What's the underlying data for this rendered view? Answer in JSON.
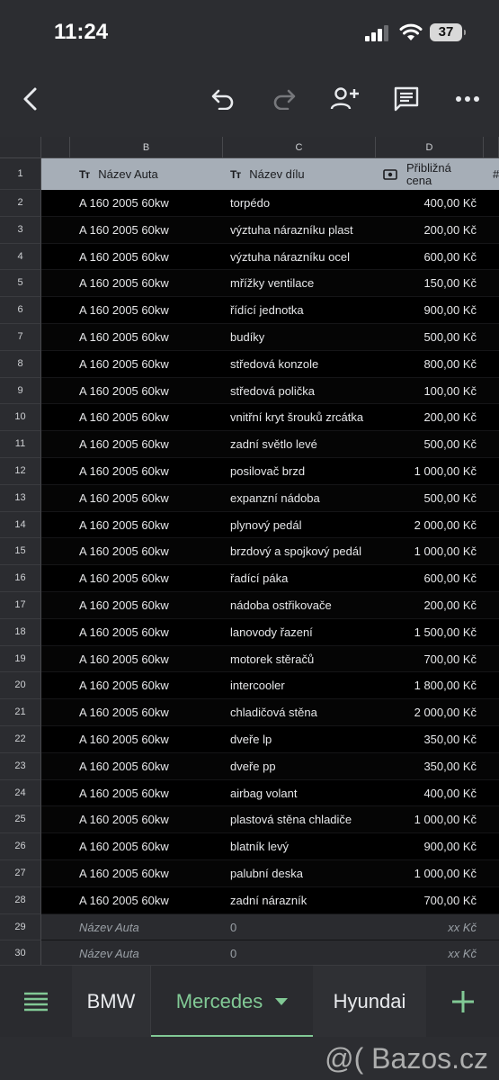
{
  "status_bar": {
    "time": "11:24",
    "battery": "37"
  },
  "toolbar": {
    "back": "back-icon",
    "undo": "undo-icon",
    "redo": "redo-icon",
    "share": "add-person-icon",
    "comments": "comment-icon",
    "more": "more-icon"
  },
  "columns": [
    "B",
    "C",
    "D"
  ],
  "header": {
    "row_number": "1",
    "col_b": "Název Auta",
    "col_c": "Název dílu",
    "col_d": "Přibližná cena",
    "col_d_line1": "Přibližná",
    "col_d_line2": "cena",
    "col_e": "#",
    "type_icon": "Tт"
  },
  "rows": [
    {
      "n": "2",
      "b": "A 160 2005 60kw",
      "c": "torpédo",
      "d": "400,00 Kč"
    },
    {
      "n": "3",
      "b": "A 160 2005 60kw",
      "c": "výztuha nárazníku plast",
      "d": "200,00 Kč"
    },
    {
      "n": "4",
      "b": "A 160 2005 60kw",
      "c": "výztuha nárazníku ocel",
      "d": "600,00 Kč"
    },
    {
      "n": "5",
      "b": "A 160 2005 60kw",
      "c": "mřížky ventilace",
      "d": "150,00 Kč"
    },
    {
      "n": "6",
      "b": "A 160 2005 60kw",
      "c": "řídící jednotka",
      "d": "900,00 Kč"
    },
    {
      "n": "7",
      "b": "A 160 2005 60kw",
      "c": "budíky",
      "d": "500,00 Kč"
    },
    {
      "n": "8",
      "b": "A 160 2005 60kw",
      "c": "středová konzole",
      "d": "800,00 Kč"
    },
    {
      "n": "9",
      "b": "A 160 2005 60kw",
      "c": "středová polička",
      "d": "100,00 Kč"
    },
    {
      "n": "10",
      "b": "A 160 2005 60kw",
      "c": "vnitřní kryt šrouků zrcátka",
      "d": "200,00 Kč"
    },
    {
      "n": "11",
      "b": "A 160 2005 60kw",
      "c": "zadní světlo levé",
      "d": "500,00 Kč"
    },
    {
      "n": "12",
      "b": "A 160 2005 60kw",
      "c": "posilovač brzd",
      "d": "1 000,00 Kč"
    },
    {
      "n": "13",
      "b": "A 160 2005 60kw",
      "c": "expanzní nádoba",
      "d": "500,00 Kč"
    },
    {
      "n": "14",
      "b": "A 160 2005 60kw",
      "c": "plynový pedál",
      "d": "2 000,00 Kč"
    },
    {
      "n": "15",
      "b": "A 160 2005 60kw",
      "c": "brzdový a spojkový pedál",
      "d": "1 000,00 Kč"
    },
    {
      "n": "16",
      "b": "A 160 2005 60kw",
      "c": "řadící páka",
      "d": "600,00 Kč"
    },
    {
      "n": "17",
      "b": "A 160 2005 60kw",
      "c": "nádoba ostřikovače",
      "d": "200,00 Kč"
    },
    {
      "n": "18",
      "b": "A 160 2005 60kw",
      "c": "lanovody řazení",
      "d": "1 500,00 Kč"
    },
    {
      "n": "19",
      "b": "A 160 2005 60kw",
      "c": "motorek stěračů",
      "d": "700,00 Kč"
    },
    {
      "n": "20",
      "b": "A 160 2005 60kw",
      "c": "intercooler",
      "d": "1 800,00 Kč"
    },
    {
      "n": "21",
      "b": "A 160 2005 60kw",
      "c": "chladičová stěna",
      "d": "2 000,00 Kč"
    },
    {
      "n": "22",
      "b": "A 160 2005 60kw",
      "c": "dveře lp",
      "d": "350,00 Kč"
    },
    {
      "n": "23",
      "b": "A 160 2005 60kw",
      "c": " dveře pp",
      "d": "350,00 Kč"
    },
    {
      "n": "24",
      "b": "A 160 2005 60kw",
      "c": "airbag volant",
      "d": "400,00 Kč"
    },
    {
      "n": "25",
      "b": "A 160 2005 60kw",
      "c": "plastová stěna chladiče",
      "d": "1 000,00 Kč"
    },
    {
      "n": "26",
      "b": "A 160 2005 60kw",
      "c": "blatník levý",
      "d": "900,00 Kč"
    },
    {
      "n": "27",
      "b": "A 160 2005 60kw",
      "c": "palubní deska",
      "d": "1 000,00 Kč"
    },
    {
      "n": "28",
      "b": "A 160 2005 60kw",
      "c": "zadní nárazník",
      "d": "700,00 Kč"
    },
    {
      "n": "29",
      "b": "Název Auta",
      "c": "0",
      "d": "xx Kč",
      "empty": true
    },
    {
      "n": "30",
      "b": "Název Auta",
      "c": "0",
      "d": "xx Kč",
      "empty": true
    }
  ],
  "tabs": {
    "bmw": "BMW",
    "mercedes": "Mercedes",
    "hyundai": "Hyundai",
    "add": "+"
  },
  "colors": {
    "accent": "#81c995",
    "header_bg": "#a6aeb7",
    "bg": "#2c2d31"
  },
  "watermark": "@( Bazos.cz"
}
